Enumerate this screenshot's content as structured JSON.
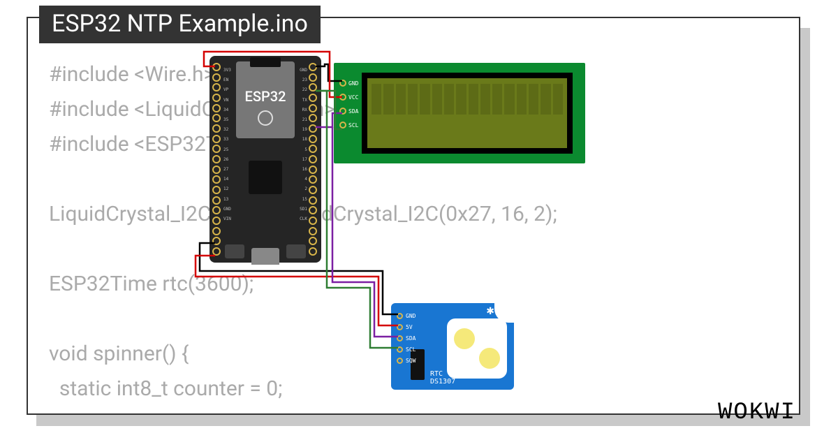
{
  "title": "ESP32 NTP Example.ino",
  "brand": "WOKWI",
  "code_preview": "#include <Wire.h>\n#include <LiquidCrystal_I2C.h>\n#include <ESP32Time.h>\n\nLiquidCrystal_I2C LCD = LiquidCrystal_I2C(0x27, 16, 2);\n\nESP32Time rtc(3600);\n\nvoid spinner() {\n  static int8_t counter = 0;",
  "components": {
    "esp32": {
      "label": "ESP32",
      "pins_left": [
        "3V3",
        "EN",
        "VP",
        "VN",
        "34",
        "35",
        "32",
        "33",
        "25",
        "26",
        "27",
        "14",
        "12",
        "13",
        "GND",
        "VIN"
      ],
      "pins_right": [
        "GND",
        "23",
        "22",
        "TX",
        "RX",
        "21",
        "19",
        "18",
        "5",
        "17",
        "16",
        "4",
        "2",
        "15",
        "SD1",
        "CLK"
      ]
    },
    "lcd": {
      "pin_labels": [
        "GND",
        "VCC",
        "SDA",
        "SCL"
      ],
      "cells": 16
    },
    "rtc": {
      "pin_labels": [
        "GND",
        "5V",
        "SDA",
        "SCL",
        "SQW"
      ],
      "label_line1": "RTC",
      "label_line2": "DS1307"
    }
  },
  "wires": [
    {
      "name": "gnd-to-lcd",
      "color": "#000"
    },
    {
      "name": "vcc-to-lcd",
      "color": "#d40000"
    },
    {
      "name": "sda-to-lcd",
      "color": "#7b1fa2"
    },
    {
      "name": "scl-to-lcd",
      "color": "#2e7d32"
    },
    {
      "name": "gnd-to-rtc",
      "color": "#000"
    },
    {
      "name": "vcc-to-rtc",
      "color": "#d40000"
    },
    {
      "name": "sda-to-rtc",
      "color": "#7b1fa2"
    },
    {
      "name": "scl-to-rtc",
      "color": "#2e7d32"
    }
  ]
}
